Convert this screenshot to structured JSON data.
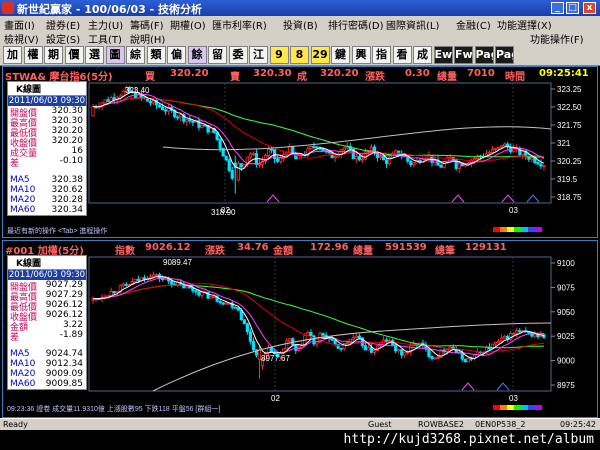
{
  "window": {
    "title": "新世紀贏家 - 100/06/03 - 技術分析",
    "min": "_",
    "max": "□",
    "close": "x"
  },
  "menu1": [
    "畫面(I)",
    "證券(E)",
    "主力(U)",
    "籌碼(F)",
    "期權(O)",
    "匯市利率(R)",
    "投資(B)",
    "排行密碼(D)",
    "國際資訊(L)",
    "金融(C)",
    "功能選擇(X)",
    "功能操作(F)"
  ],
  "menu2": [
    "檢視(V)",
    "設定(S)",
    "工具(T)",
    "說明(H)"
  ],
  "toolbar": [
    "加",
    "權",
    "期",
    "價",
    "選",
    "圖",
    "綜",
    "類",
    "偏",
    "餘",
    "留",
    "委",
    "江",
    "9",
    "8",
    "29",
    "鍵",
    "興",
    "指",
    "看",
    "成",
    "Ew",
    "Fw",
    "Page",
    "Page"
  ],
  "status": {
    "left": "Ready",
    "user": "Guest",
    "server": "ROWBASE2",
    "session": "0EN0P538_2",
    "clock": "09:25:42"
  },
  "watermark": "http://kujd3268.pixnet.net/album",
  "panels": [
    {
      "header": {
        "symbol": "STWA& 摩台指6(5分)",
        "buy_label": "買",
        "buy": "320.20",
        "sell_label": "賣",
        "sell": "320.30",
        "deal_label": "成",
        "deal": "320.20",
        "change_label": "漲跌",
        "change": "0.30",
        "volume_label": "總量",
        "volume": "7010",
        "time_label": "時間",
        "time": "09:25:41"
      },
      "info": {
        "title": "K線圖",
        "date": "2011/06/03 09:30",
        "rows": [
          {
            "label": "開盤價",
            "value": "320.30"
          },
          {
            "label": "最高價",
            "value": "320.30"
          },
          {
            "label": "最低價",
            "value": "320.20"
          },
          {
            "label": "收盤價",
            "value": "320.20"
          },
          {
            "label": "成交量",
            "value": "16"
          },
          {
            "label": "差",
            "value": "-0.10"
          }
        ],
        "ma": [
          {
            "label": "MA5",
            "value": "320.38"
          },
          {
            "label": "MA10",
            "value": "320.62"
          },
          {
            "label": "MA20",
            "value": "320.28"
          },
          {
            "label": "MA60",
            "value": "320.34"
          }
        ]
      },
      "yticks": [
        "323.25",
        "322.50",
        "321.75",
        "321",
        "320.25",
        "319.5",
        "318.75"
      ],
      "xticks": [
        "02",
        "03"
      ],
      "high_label": "323.40",
      "low_label": "318.90",
      "footer": "最近有新的操作 <Tab> 進程操作"
    },
    {
      "header": {
        "symbol": "#001 加權(5分)",
        "index_label": "指數",
        "index": "9026.12",
        "change_label": "漲跌",
        "change": "34.76",
        "amount_label": "金額",
        "amount": "172.96",
        "volume_label": "總量",
        "volume": "591539",
        "count_label": "總筆",
        "count": "129131"
      },
      "info": {
        "title": "K線圖",
        "date": "2011/06/03 09:30",
        "rows": [
          {
            "label": "開盤價",
            "value": "9027.29"
          },
          {
            "label": "最高價",
            "value": "9027.29"
          },
          {
            "label": "最低價",
            "value": "9026.12"
          },
          {
            "label": "收盤價",
            "value": "9026.12"
          },
          {
            "label": "金額",
            "value": "3.22"
          },
          {
            "label": "差",
            "value": "-1.89"
          }
        ],
        "ma": [
          {
            "label": "MA5",
            "value": "9024.74"
          },
          {
            "label": "MA10",
            "value": "9012.34"
          },
          {
            "label": "MA20",
            "value": "9009.09"
          },
          {
            "label": "MA60",
            "value": "9009.85"
          }
        ]
      },
      "yticks": [
        "9100",
        "9075",
        "9050",
        "9025",
        "9000",
        "8975"
      ],
      "xticks": [
        "02",
        "03"
      ],
      "high_label": "9089.47",
      "low_label": "8977.67",
      "footer": "09:23:36 證卷 成交量11.9310億 上漲股數95 下跌118 平盤56 [群組一]"
    }
  ],
  "colors": {
    "up": "#ff3030",
    "down": "#00e0ff",
    "ma5": "#ffffff",
    "ma10": "#ff40ff",
    "ma20": "#e00000",
    "ma60": "#40ff40",
    "long": "#c0c0c0"
  }
}
